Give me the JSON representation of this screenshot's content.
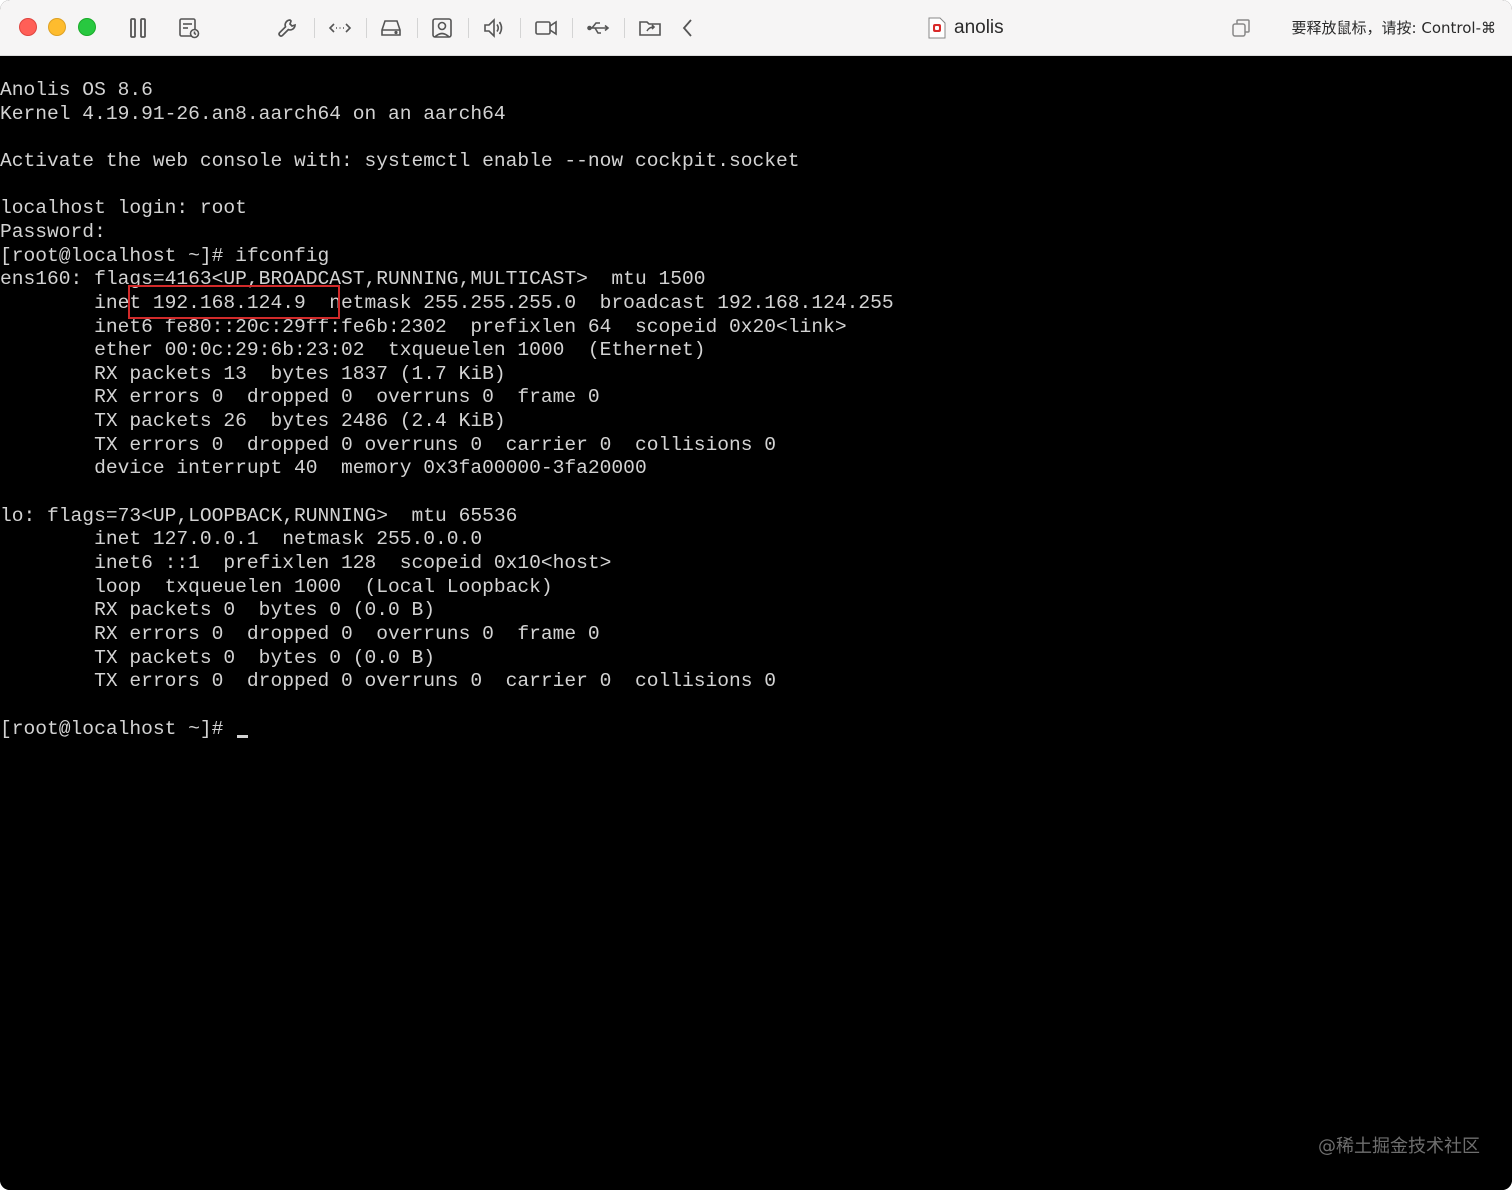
{
  "window": {
    "title": "anolis",
    "release_hint": "要释放鼠标，请按: Control-⌘"
  },
  "toolbar": {
    "icons": [
      "pause-icon",
      "snapshot-icon",
      "settings-wrench-icon",
      "network-arrows-icon",
      "disk-drive-icon",
      "camera-share-icon",
      "speaker-icon",
      "video-camera-icon",
      "usb-icon",
      "shared-folder-icon",
      "chevron-left-icon"
    ]
  },
  "terminal": {
    "lines": [
      "Anolis OS 8.6",
      "Kernel 4.19.91-26.an8.aarch64 on an aarch64",
      "",
      "Activate the web console with: systemctl enable --now cockpit.socket",
      "",
      "localhost login: root",
      "Password:",
      "[root@localhost ~]# ifconfig",
      "ens160: flags=4163<UP,BROADCAST,RUNNING,MULTICAST>  mtu 1500",
      "        inet 192.168.124.9  netmask 255.255.255.0  broadcast 192.168.124.255",
      "        inet6 fe80::20c:29ff:fe6b:2302  prefixlen 64  scopeid 0x20<link>",
      "        ether 00:0c:29:6b:23:02  txqueuelen 1000  (Ethernet)",
      "        RX packets 13  bytes 1837 (1.7 KiB)",
      "        RX errors 0  dropped 0  overruns 0  frame 0",
      "        TX packets 26  bytes 2486 (2.4 KiB)",
      "        TX errors 0  dropped 0 overruns 0  carrier 0  collisions 0",
      "        device interrupt 40  memory 0x3fa00000-3fa20000",
      "",
      "lo: flags=73<UP,LOOPBACK,RUNNING>  mtu 65536",
      "        inet 127.0.0.1  netmask 255.0.0.0",
      "        inet6 ::1  prefixlen 128  scopeid 0x10<host>",
      "        loop  txqueuelen 1000  (Local Loopback)",
      "        RX packets 0  bytes 0 (0.0 B)",
      "        RX errors 0  dropped 0  overruns 0  frame 0",
      "        TX packets 0  bytes 0 (0.0 B)",
      "        TX errors 0  dropped 0 overruns 0  carrier 0  collisions 0",
      "",
      "[root@localhost ~]# "
    ]
  },
  "watermark": "@稀土掘金技术社区",
  "colors": {
    "console_bg": "#000000",
    "console_fg": "#d3d3d3",
    "highlight": "#d12a2a",
    "titlebar_bg": "#f6f5f5"
  }
}
